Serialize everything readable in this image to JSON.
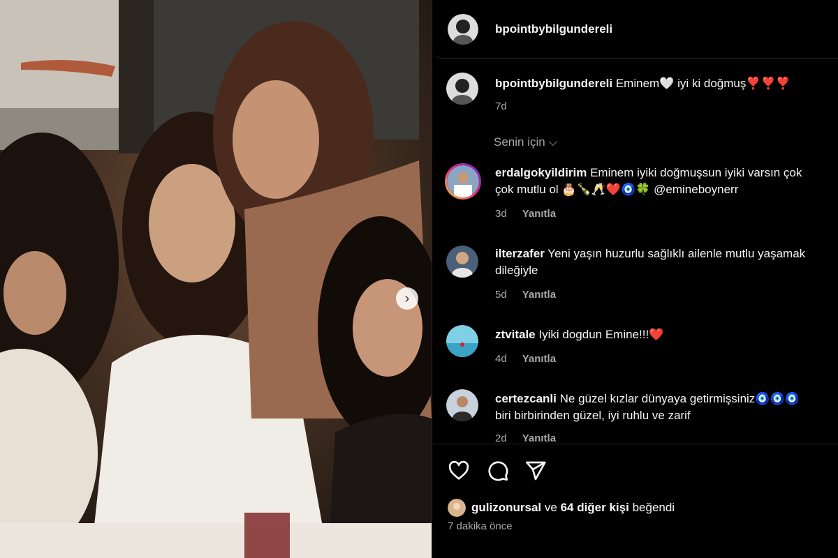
{
  "post": {
    "owner": "bpointbybilgundereli",
    "caption": "Eminem🤍 iyi ki doğmuş❣️❣️❣️",
    "caption_age": "7d",
    "likes_user": "gulizonursal",
    "likes_connector": "ve",
    "likes_count_text": "64 diğer kişi",
    "likes_suffix": "beğendi",
    "posted_ago": "7 dakika önce"
  },
  "filter": {
    "label": "Senin için ⌵"
  },
  "comments": [
    {
      "user": "erdalgokyildirim",
      "text_line1": "Eminem iyiki doğmuşsun iyiki varsın çok",
      "text_line2": "çok mutlu ol 🎂🍾🥂❤️🧿🍀 @emineboynerr",
      "age": "3d",
      "reply": "Yanıtla"
    },
    {
      "user": "ilterzafer",
      "text_line1": "Yeni yaşın huzurlu sağlıklı ailenle mutlu yaşamak",
      "text_line2": "dileğiyle",
      "age": "5d",
      "reply": "Yanıtla"
    },
    {
      "user": "ztvitale",
      "text_line1": "Iyiki dogdun Emine!!!❤️",
      "text_line2": "",
      "age": "4d",
      "reply": "Yanıtla"
    },
    {
      "user": "certezcanli",
      "text_line1": "Ne güzel kızlar dünyaya getirmişsiniz🧿🧿🧿",
      "text_line2": "biri birbirinden güzel, iyi ruhlu ve zarif",
      "age": "2d",
      "reply": "Yanıtla"
    }
  ],
  "icons": {
    "like": "heart-icon",
    "comment": "comment-icon",
    "share": "send-icon",
    "next": "chevron-right-icon"
  },
  "colors": {
    "background": "#000000",
    "text": "#f5f5f5",
    "secondary": "#a8a8a8",
    "divider": "#262626"
  }
}
